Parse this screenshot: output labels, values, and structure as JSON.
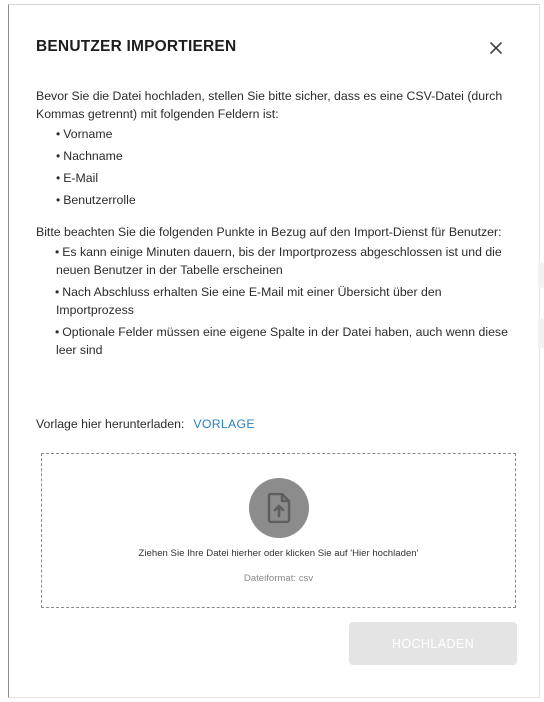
{
  "dialog": {
    "title": "BENUTZER IMPORTIEREN",
    "close_icon": "close-icon"
  },
  "content": {
    "intro": "Bevor Sie die Datei hochladen, stellen Sie bitte sicher, dass es eine CSV-Datei (durch Kommas getrennt) mit folgenden Feldern ist:",
    "fields": [
      "Vorname",
      "Nachname",
      "E-Mail",
      "Benutzerrolle"
    ],
    "notes_intro": "Bitte beachten Sie die folgenden Punkte in Bezug auf den Import-Dienst für Benutzer:",
    "notes": [
      "Es kann einige Minuten dauern, bis der Importprozess abgeschlossen ist und die neuen Benutzer in der Tabelle erscheinen",
      "Nach Abschluss erhalten Sie eine E-Mail mit einer Übersicht über den Importprozess",
      "Optionale Felder müssen eine eigene Spalte in der Datei haben, auch wenn diese leer sind"
    ],
    "bullet_char": "•"
  },
  "template": {
    "label": "Vorlage hier herunterladen:",
    "link": "VORLAGE"
  },
  "dropzone": {
    "icon": "file-upload-icon",
    "instruction": "Ziehen Sie Ihre Datei hierher oder klicken Sie auf 'Hier hochladen'",
    "format": "Dateiformat: csv"
  },
  "upload_button": {
    "label": "HOCHLADEN",
    "state": "disabled"
  },
  "colors": {
    "link": "#2a7fc0",
    "button_disabled": "#e4e4e4",
    "icon_circle": "#8c8c8c",
    "dropzone_border": "#8a8a8a"
  }
}
